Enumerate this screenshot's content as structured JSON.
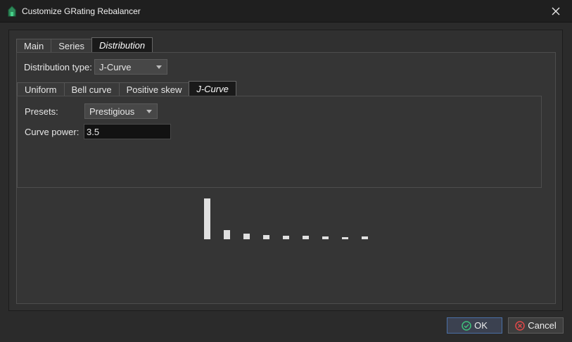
{
  "window": {
    "title": "Customize GRating Rebalancer"
  },
  "tabs": [
    "Main",
    "Series",
    "Distribution"
  ],
  "distribution": {
    "type_label": "Distribution type:",
    "type_value": "J-Curve"
  },
  "subtabs": [
    "Uniform",
    "Bell curve",
    "Positive skew",
    "J-Curve"
  ],
  "jcurve": {
    "presets_label": "Presets:",
    "presets_value": "Prestigious",
    "power_label": "Curve power:",
    "power_value": "3.5"
  },
  "chart_data": {
    "type": "bar",
    "values": [
      58,
      13,
      8,
      6,
      5,
      5,
      4,
      3,
      4
    ],
    "ylim": [
      0,
      58
    ],
    "color": "#e0e0e0"
  },
  "buttons": {
    "ok": "OK",
    "cancel": "Cancel"
  },
  "colors": {
    "ok_icon": "#3ec07a",
    "cancel_icon": "#e04848",
    "app_icon": "#3aa86a"
  }
}
